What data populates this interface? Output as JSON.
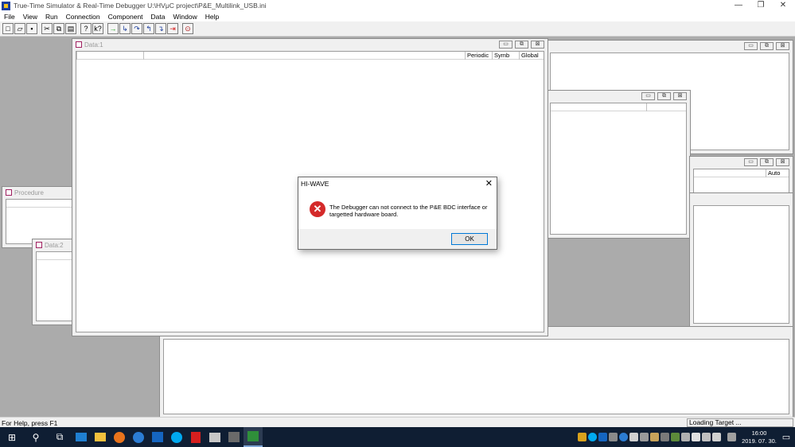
{
  "app": {
    "title": "True-Time Simulator & Real-Time Debugger   U:\\HVμC project\\P&E_Multilink_USB.ini"
  },
  "window_controls": {
    "minimize": "—",
    "restore": "❐",
    "close": "✕"
  },
  "menu": [
    "File",
    "View",
    "Run",
    "Connection",
    "Component",
    "Data",
    "Window",
    "Help"
  ],
  "toolbar": {
    "buttons": [
      {
        "icon": "new-icon",
        "glyph": "□"
      },
      {
        "icon": "open-icon",
        "glyph": "▱"
      },
      {
        "icon": "save-icon",
        "glyph": "▪"
      },
      {
        "icon": "cut-icon",
        "glyph": "✂"
      },
      {
        "icon": "copy-icon",
        "glyph": "⧉"
      },
      {
        "icon": "paste-icon",
        "glyph": "▤"
      },
      {
        "icon": "help-icon",
        "glyph": "?"
      },
      {
        "icon": "context-help-icon",
        "glyph": "k?"
      },
      {
        "icon": "start-icon",
        "glyph": "→"
      },
      {
        "icon": "single-step-icon",
        "glyph": "↳"
      },
      {
        "icon": "step-over-icon",
        "glyph": "↷"
      },
      {
        "icon": "step-out-icon",
        "glyph": "↰"
      },
      {
        "icon": "assembly-step-icon",
        "glyph": "↴"
      },
      {
        "icon": "halt-icon",
        "glyph": "⇥"
      },
      {
        "icon": "reset-icon",
        "glyph": "⊙"
      }
    ]
  },
  "windows": {
    "data1": {
      "title": "Data:1",
      "columns": [
        "Periodic",
        "Symb",
        "Global"
      ]
    },
    "procedure": {
      "title": "Procedure"
    },
    "data2": {
      "title": "Data:2"
    },
    "right_top": {
      "title": ""
    },
    "right_mid": {
      "title": ""
    },
    "right_regs": {
      "title": "",
      "auto_label": "Auto"
    },
    "bottom": {
      "title": ""
    },
    "mdi_buttons": {
      "minimize": "▭",
      "restore": "⧉",
      "close": "⊠"
    }
  },
  "dialog": {
    "title": "HI-WAVE",
    "close": "✕",
    "icon": "error-icon",
    "icon_glyph": "✕",
    "message": "The Debugger can not connect to the P&E BDC interface or targetted hardware board.",
    "ok_label": "OK",
    "accent": "#d42a2a"
  },
  "statusbar": {
    "left": "For Help, press F1",
    "right": "Loading Target ..."
  },
  "taskbar": {
    "start_glyph": "⊞",
    "search_glyph": "⚲",
    "taskview_glyph": "⧉",
    "apps": [
      {
        "icon": "monitor-app-icon",
        "color": "#1f7fd1"
      },
      {
        "icon": "file-explorer-icon",
        "color": "#f2c03d"
      },
      {
        "icon": "firefox-icon",
        "color": "#e8731c"
      },
      {
        "icon": "edge-icon",
        "color": "#2b7cd3"
      },
      {
        "icon": "outlook-icon",
        "color": "#1565c0"
      },
      {
        "icon": "skype-icon",
        "color": "#00a9f0"
      },
      {
        "icon": "acrobat-icon",
        "color": "#d61f1f"
      },
      {
        "icon": "app-window-icon",
        "color": "#c7c7c7"
      },
      {
        "icon": "film-app-icon",
        "color": "#6a6a6a"
      },
      {
        "icon": "hiwave-taskbar-icon",
        "color": "#2f8f3a"
      }
    ],
    "clock_time": "16:00",
    "clock_date": "2019. 07. 30.",
    "notification_glyph": "▭"
  }
}
